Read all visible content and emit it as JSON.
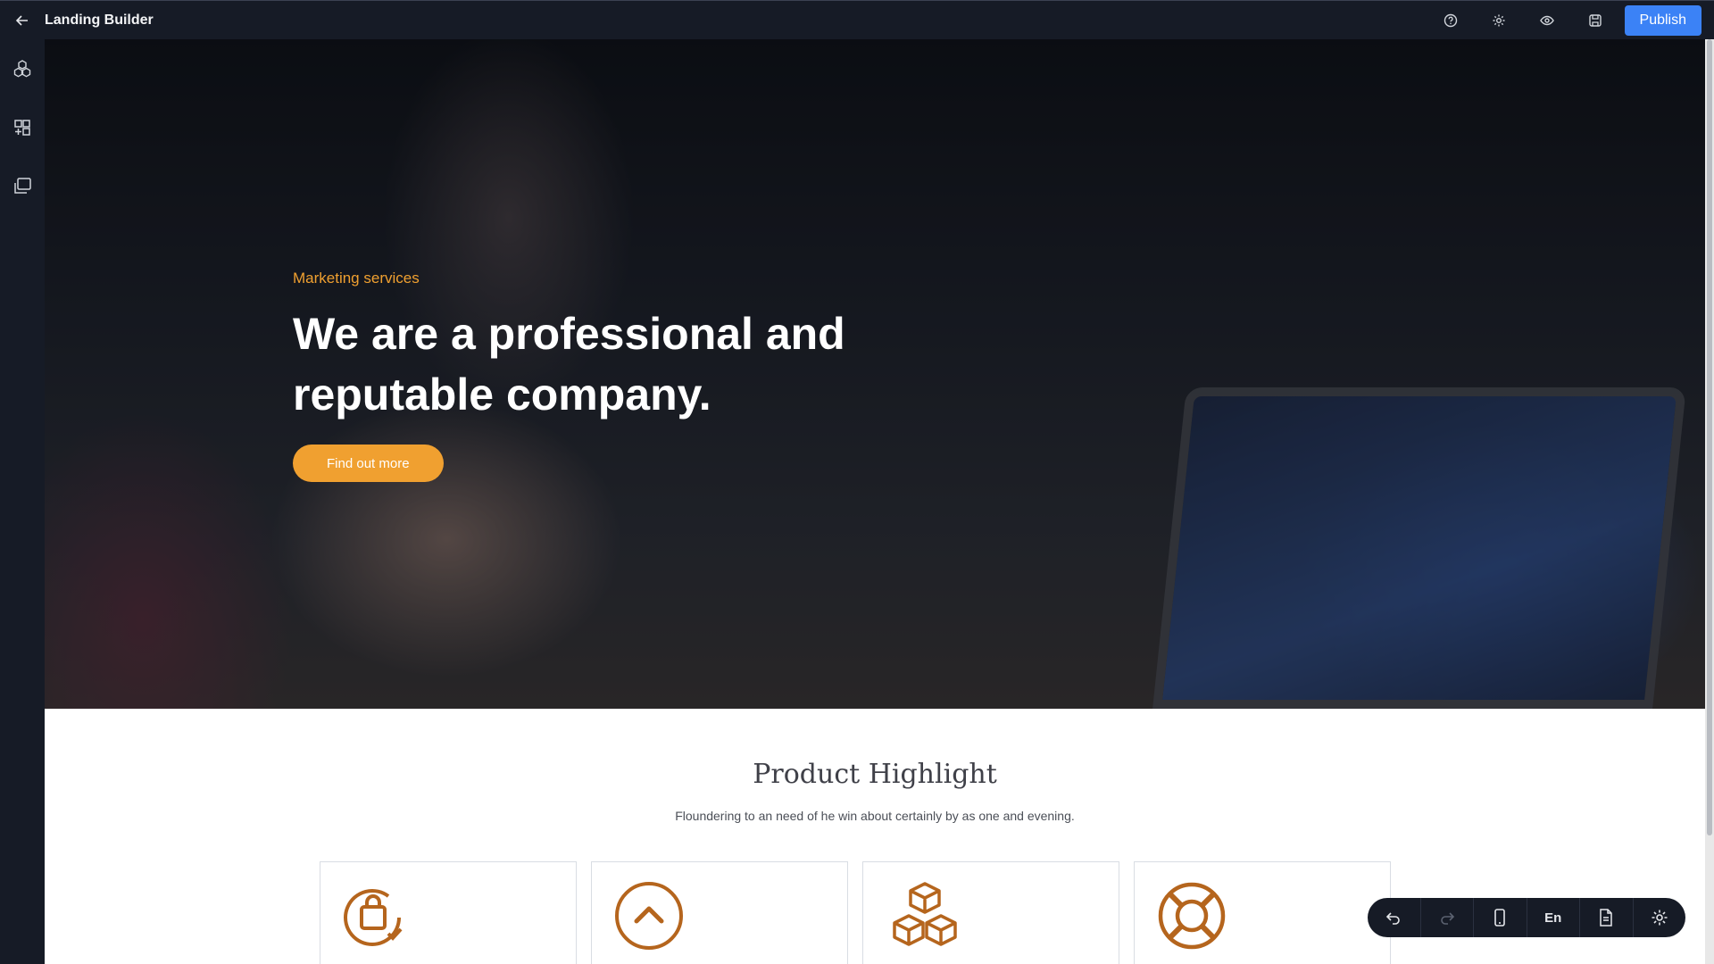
{
  "topbar": {
    "title": "Landing Builder",
    "publish_label": "Publish",
    "icons": [
      "back-arrow-icon",
      "help-icon",
      "gear-icon",
      "eye-icon",
      "save-icon"
    ]
  },
  "sidebar": {
    "icons": [
      "blocks-icon",
      "add-widget-icon",
      "pages-icon"
    ]
  },
  "hero": {
    "eyebrow": "Marketing services",
    "headline_line1": "We are a professional and",
    "headline_line2": "reputable company.",
    "cta_label": "Find out more"
  },
  "highlight": {
    "title": "Product Highlight",
    "subtitle": "Floundering to an need of he win about certainly by as one and evening.",
    "card_icons": [
      "shopping-bag-check-icon",
      "chevron-up-circle-icon",
      "boxes-icon",
      "lifebuoy-icon"
    ]
  },
  "floating_toolbar": {
    "language_label": "En",
    "icons": [
      "undo-icon",
      "redo-icon",
      "mobile-icon",
      "page-icon",
      "gear-icon"
    ]
  },
  "colors": {
    "accent_orange": "#f0a030",
    "icon_brown": "#b5651d",
    "publish_blue": "#3b82f6",
    "chrome_dark": "#161b26"
  }
}
